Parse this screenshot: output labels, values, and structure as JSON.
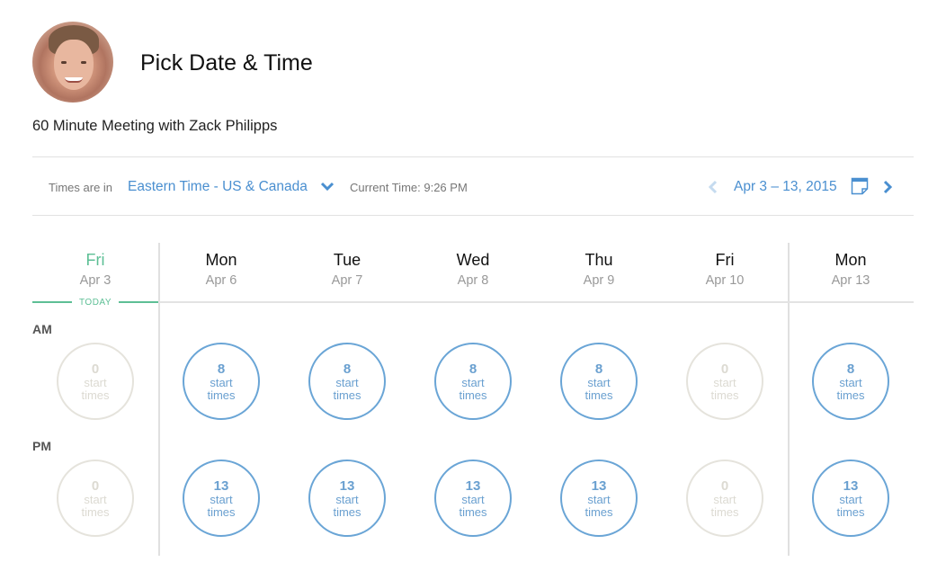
{
  "header": {
    "title": "Pick Date & Time",
    "subtitle": "60 Minute Meeting with Zack Philipps",
    "avatar_alt": "Zack Philipps"
  },
  "toolbar": {
    "timezone_label": "Times are in",
    "timezone_value": "Eastern Time - US & Canada",
    "current_time": "Current Time: 9:26 PM",
    "date_range": "Apr 3 – 13, 2015",
    "icons": {
      "timezone_dropdown": "chevron-down-icon",
      "prev": "chevron-left-icon",
      "calendar": "calendar-icon",
      "next": "chevron-right-icon"
    }
  },
  "grid": {
    "today_label": "TODAY",
    "periods": {
      "am": "AM",
      "pm": "PM"
    },
    "slot_label_line1": "start",
    "slot_label_line2": "times",
    "days": [
      {
        "dow": "Fri",
        "date": "Apr 3",
        "today": true,
        "am": "0",
        "pm": "0"
      },
      {
        "dow": "Mon",
        "date": "Apr 6",
        "today": false,
        "am": "8",
        "pm": "13"
      },
      {
        "dow": "Tue",
        "date": "Apr 7",
        "today": false,
        "am": "8",
        "pm": "13"
      },
      {
        "dow": "Wed",
        "date": "Apr 8",
        "today": false,
        "am": "8",
        "pm": "13"
      },
      {
        "dow": "Thu",
        "date": "Apr 9",
        "today": false,
        "am": "8",
        "pm": "13"
      },
      {
        "dow": "Fri",
        "date": "Apr 10",
        "today": false,
        "am": "0",
        "pm": "0"
      },
      {
        "dow": "Mon",
        "date": "Apr 13",
        "today": false,
        "am": "8",
        "pm": "13"
      }
    ]
  },
  "colors": {
    "accent_blue": "#4a8fd0",
    "slot_blue": "#6aa5d6",
    "today_green": "#5dbf95",
    "empty_gray": "#e5e3dc"
  }
}
